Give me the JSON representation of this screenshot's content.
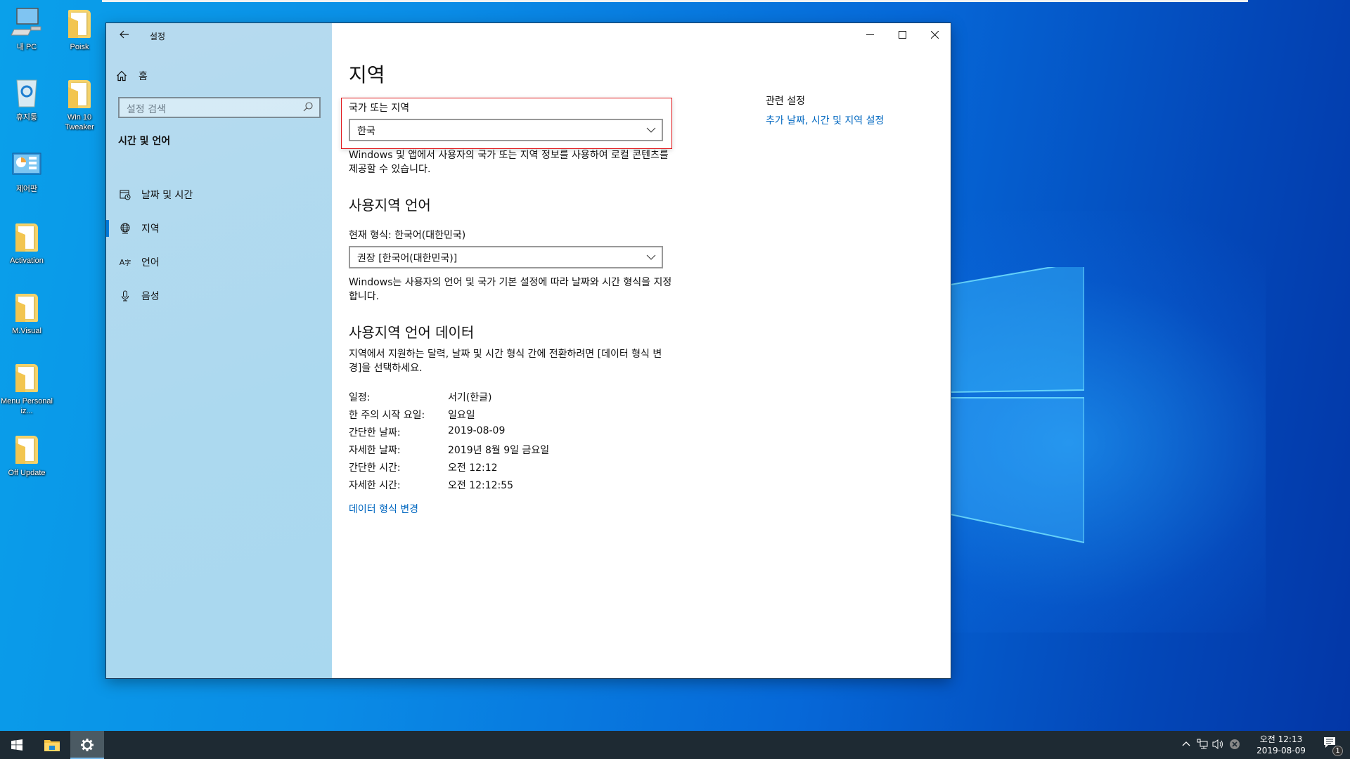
{
  "desktop": {
    "icons": [
      {
        "label": "내 PC",
        "icon": "computer-icon"
      },
      {
        "label": "Poisk",
        "icon": "folder-icon"
      },
      {
        "label": "휴지통",
        "icon": "recycle-bin-icon"
      },
      {
        "label": "Win 10 Tweaker",
        "icon": "folder-icon"
      },
      {
        "label": "제어판",
        "icon": "control-panel-icon"
      },
      {
        "label": "Activation",
        "icon": "folder-icon"
      },
      {
        "label": "M.Visual",
        "icon": "folder-icon"
      },
      {
        "label": "Menu Personaliz...",
        "icon": "folder-icon"
      },
      {
        "label": "Off Update",
        "icon": "folder-icon"
      }
    ]
  },
  "window": {
    "title": "설정",
    "controls": {
      "minimize": "─",
      "maximize": "☐",
      "close": "✕"
    }
  },
  "sidebar": {
    "home_label": "홈",
    "search_placeholder": "설정 검색",
    "group_title": "시간 및 언어",
    "items": [
      {
        "label": "날짜 및 시간",
        "icon": "calendar-clock-icon",
        "active": false
      },
      {
        "label": "지역",
        "icon": "globe-icon",
        "active": true
      },
      {
        "label": "언어",
        "icon": "language-icon",
        "active": false
      },
      {
        "label": "음성",
        "icon": "microphone-icon",
        "active": false
      }
    ]
  },
  "main": {
    "title": "지역",
    "country": {
      "label": "국가 또는 지역",
      "value": "한국",
      "description": "Windows 및 앱에서 사용자의 국가 또는 지역 정보를 사용하여 로컬 콘텐츠를 제공할 수 있습니다."
    },
    "regional_format": {
      "heading": "사용지역 언어",
      "label": "현재 형식: 한국어(대한민국)",
      "value": "권장 [한국어(대한민국)]",
      "description": "Windows는 사용자의 언어 및 국가 기본 설정에 따라 날짜와 시간 형식을 지정합니다."
    },
    "format_data": {
      "heading": "사용지역 언어 데이터",
      "description": "지역에서 지원하는 달력, 날짜 및 시간 형식 간에 전환하려면 [데이터 형식 변경]을 선택하세요.",
      "rows": [
        {
          "key": "일정:",
          "value": "서기(한글)"
        },
        {
          "key": "한 주의 시작 요일:",
          "value": "일요일"
        },
        {
          "key": "간단한 날짜:",
          "value": "2019-08-09"
        },
        {
          "key": "자세한 날짜:",
          "value": "2019년 8월 9일 금요일"
        },
        {
          "key": "간단한 시간:",
          "value": "오전 12:12"
        },
        {
          "key": "자세한 시간:",
          "value": "오전 12:12:55"
        }
      ],
      "change_link": "데이터 형식 변경"
    },
    "related": {
      "title": "관련 설정",
      "link": "추가 날짜, 시간 및 지역 설정"
    }
  },
  "taskbar": {
    "clock_time": "오전 12:13",
    "clock_date": "2019-08-09",
    "notification_count": "1"
  },
  "colors": {
    "accent": "#0078d7",
    "link": "#0067c0",
    "highlight_border": "#e0161a",
    "sidebar_bg": "#acd9ef"
  }
}
